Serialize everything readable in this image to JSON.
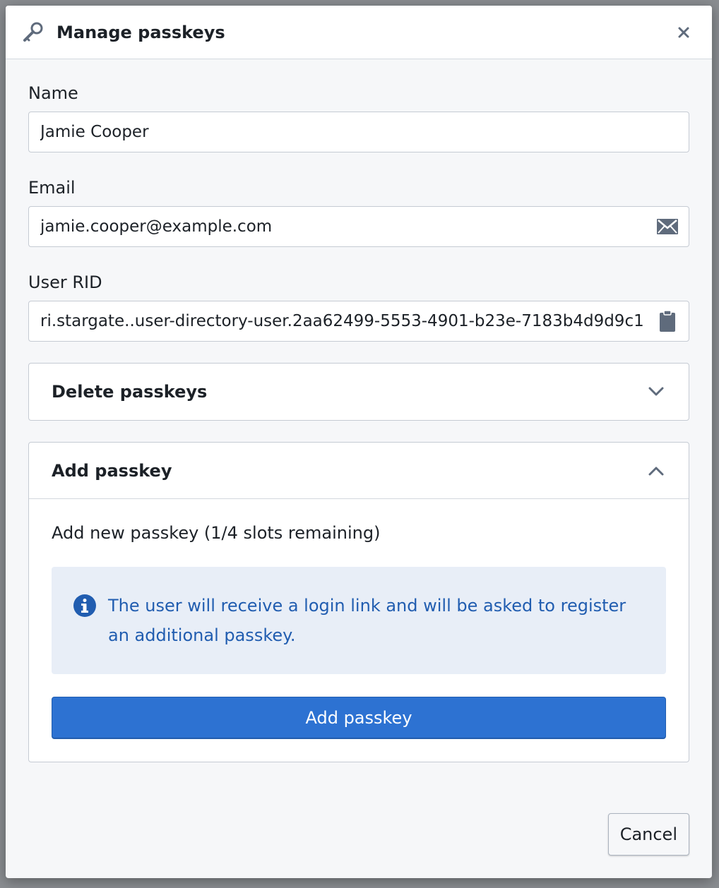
{
  "dialog": {
    "title": "Manage passkeys",
    "title_icon": "key-icon",
    "close_icon": "close-icon"
  },
  "fields": {
    "name": {
      "label": "Name",
      "value": "Jamie Cooper"
    },
    "email": {
      "label": "Email",
      "value": "jamie.cooper@example.com",
      "icon": "envelope-icon"
    },
    "user_rid": {
      "label": "User RID",
      "value": "ri.stargate..user-directory-user.2aa62499-5553-4901-b23e-7183b4d9d9c1",
      "icon": "clipboard-icon"
    }
  },
  "delete_section": {
    "title": "Delete passkeys",
    "icon": "chevron-down-icon"
  },
  "add_section": {
    "title": "Add passkey",
    "icon": "chevron-up-icon",
    "slots_text": "Add new passkey (1/4 slots remaining)",
    "callout_icon": "info-icon",
    "callout_text": "The user will receive a login link and will be asked to register an additional passkey.",
    "button_label": "Add passkey"
  },
  "footer": {
    "cancel_label": "Cancel"
  },
  "colors": {
    "primary": "#2d72d2",
    "callout_bg": "#e8eef7",
    "callout_text": "#215db0"
  }
}
